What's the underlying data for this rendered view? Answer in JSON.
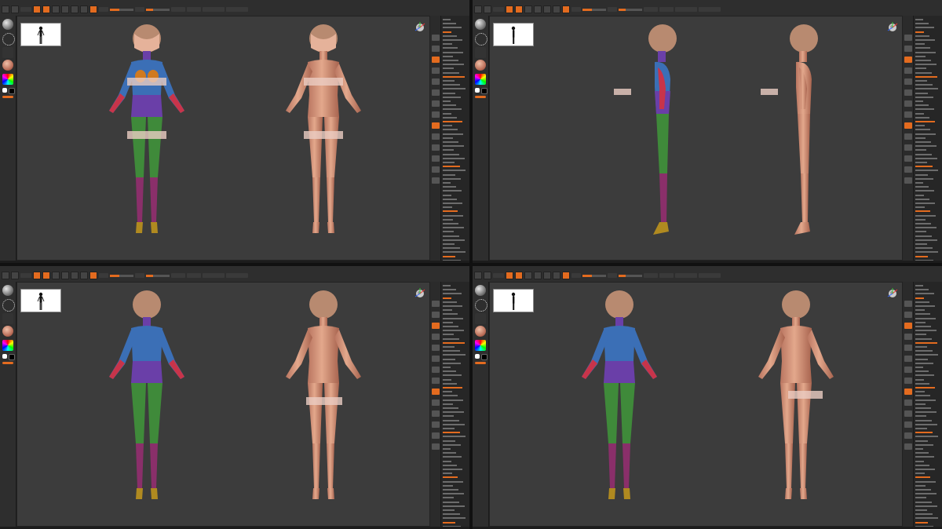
{
  "panes": [
    {
      "id": "front",
      "view": "front"
    },
    {
      "id": "side",
      "view": "side"
    },
    {
      "id": "back",
      "view": "back"
    },
    {
      "id": "three-quarter-back",
      "view": "three-quarter-back"
    }
  ],
  "colors": {
    "accent": "#e36b1f",
    "ui_bg": "#2a2a2a",
    "canvas_bg": "#3c3c3c",
    "skin": "#d89a80",
    "hair": "#b88a70",
    "polygroup_red": "#c8344a",
    "polygroup_blue": "#3b6fb6",
    "polygroup_purple": "#6a3fa8",
    "polygroup_green": "#3f8a3a",
    "polygroup_magenta": "#8a2f6a",
    "polygroup_orange": "#d07a20"
  },
  "icons": [
    "sphere-brush-icon",
    "stroke-dots-icon",
    "material-icon",
    "color-picker-icon",
    "camera-gizmo-icon",
    "silhouette-icon"
  ]
}
